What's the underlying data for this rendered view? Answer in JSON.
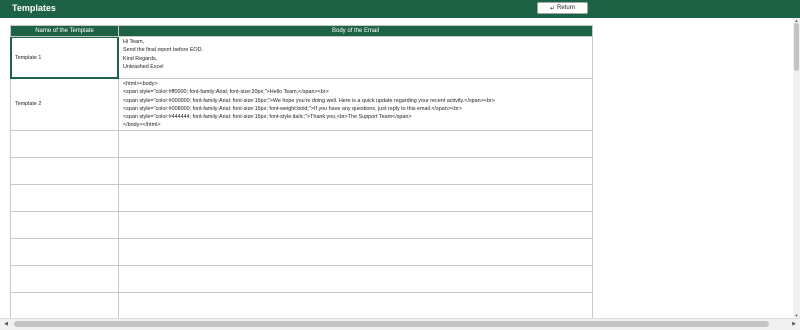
{
  "header": {
    "title": "Templates",
    "return_label": "Return",
    "return_icon": "return-arrow-icon",
    "bg_color": "#1e6245"
  },
  "table": {
    "columns": [
      "Name of the Template",
      "Body of the Email"
    ],
    "rows": [
      {
        "name": "Template 1",
        "body_lines": [
          "Hi Team,",
          "Send the final report before EOD.",
          "",
          "Kind Regards,",
          "Unleashed Excel"
        ]
      },
      {
        "name": "Template 2",
        "body_lines": [
          "<html><body>",
          "<span style=\"color:#ff0000; font-family:Arial; font-size:20px;\">Hello Team,</span><br>",
          "<span style=\"color:#000000; font-family:Arial; font-size:16px;\">We hope you're doing well. Here is a quick update regarding your recent activity.</span><br>",
          "<span style=\"color:#008000; font-family:Arial; font-size:16px; font-weight:bold;\">If you have any questions, just reply to this email.</span><br>",
          "<span style=\"color:#444444; font-family:Arial; font-size:16px; font-style:italic;\">Thank you,<br>The Support Team</span>",
          "</body></html>"
        ]
      }
    ]
  }
}
